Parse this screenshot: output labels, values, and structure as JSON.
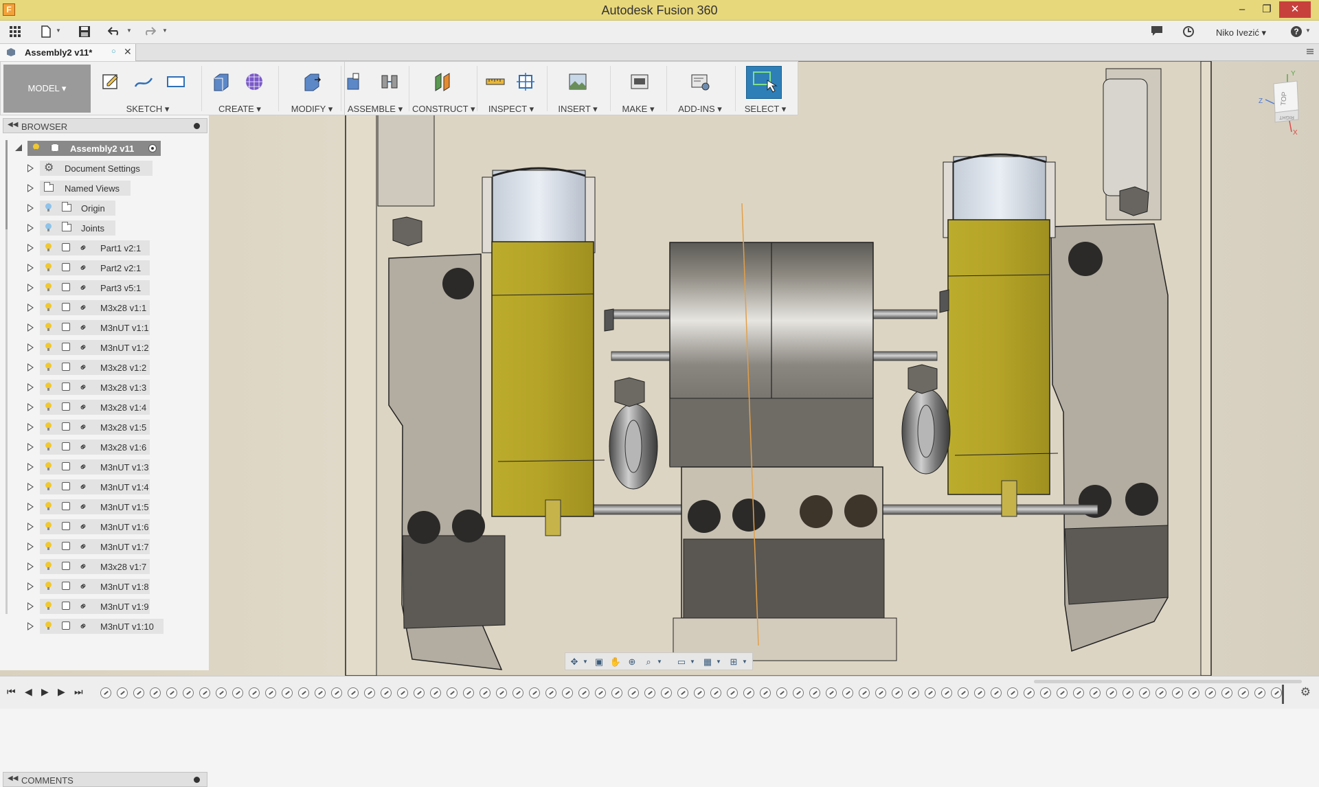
{
  "window": {
    "title": "Autodesk Fusion 360",
    "app_icon": "F",
    "minimize": "–",
    "restore": "❐",
    "close": "✕"
  },
  "toolbar": {
    "user_name": "Niko Ivezić ▾",
    "help": "?",
    "icons": [
      "grid-icon",
      "file-icon",
      "save-icon",
      "undo-icon",
      "redo-icon",
      "comment-icon",
      "clock-icon",
      "help-icon"
    ]
  },
  "tab": {
    "label": "Assembly2 v11*",
    "saved_glyph": "○",
    "close": "✕"
  },
  "ribbon": {
    "mode": "MODEL ▾",
    "groups": [
      {
        "label": "SKETCH ▾"
      },
      {
        "label": "CREATE ▾"
      },
      {
        "label": "MODIFY ▾"
      },
      {
        "label": "ASSEMBLE ▾"
      },
      {
        "label": "CONSTRUCT ▾"
      },
      {
        "label": "INSPECT ▾"
      },
      {
        "label": "INSERT ▾"
      },
      {
        "label": "MAKE ▾"
      },
      {
        "label": "ADD-INS ▾"
      },
      {
        "label": "SELECT ▾"
      }
    ],
    "active_group": "SELECT"
  },
  "browser": {
    "header": "BROWSER",
    "root": "Assembly2 v11",
    "items": [
      {
        "label": "Document Settings",
        "type": "settings"
      },
      {
        "label": "Named Views",
        "type": "folder"
      },
      {
        "label": "Origin",
        "type": "folder-light"
      },
      {
        "label": "Joints",
        "type": "folder-light"
      },
      {
        "label": "Part1 v2:1",
        "type": "component"
      },
      {
        "label": "Part2 v2:1",
        "type": "component"
      },
      {
        "label": "Part3 v5:1",
        "type": "component"
      },
      {
        "label": "M3x28 v1:1",
        "type": "component"
      },
      {
        "label": "M3nUT v1:1",
        "type": "component"
      },
      {
        "label": "M3nUT v1:2",
        "type": "component"
      },
      {
        "label": "M3x28 v1:2",
        "type": "component"
      },
      {
        "label": "M3x28 v1:3",
        "type": "component"
      },
      {
        "label": "M3x28 v1:4",
        "type": "component"
      },
      {
        "label": "M3x28 v1:5",
        "type": "component"
      },
      {
        "label": "M3x28 v1:6",
        "type": "component"
      },
      {
        "label": "M3nUT v1:3",
        "type": "component"
      },
      {
        "label": "M3nUT v1:4",
        "type": "component"
      },
      {
        "label": "M3nUT v1:5",
        "type": "component"
      },
      {
        "label": "M3nUT v1:6",
        "type": "component"
      },
      {
        "label": "M3nUT v1:7",
        "type": "component"
      },
      {
        "label": "M3x28 v1:7",
        "type": "component"
      },
      {
        "label": "M3nUT v1:8",
        "type": "component"
      },
      {
        "label": "M3nUT v1:9",
        "type": "component"
      },
      {
        "label": "M3nUT v1:10",
        "type": "component"
      }
    ]
  },
  "comments": {
    "header": "COMMENTS"
  },
  "viewcube": {
    "face_top": "TOP",
    "face_right": "RIGHT",
    "axis_y": "Y",
    "axis_z": "Z",
    "axis_x": "X"
  },
  "timeline": {
    "controls": [
      "⏮",
      "◀",
      "▶",
      "▶",
      "⏭"
    ],
    "feature_count": 72
  },
  "colors": {
    "titlebar": "#e8d87c",
    "accent": "#2e7fb8",
    "part_yellow": "#b8a62a",
    "part_gray": "#9c968a"
  }
}
